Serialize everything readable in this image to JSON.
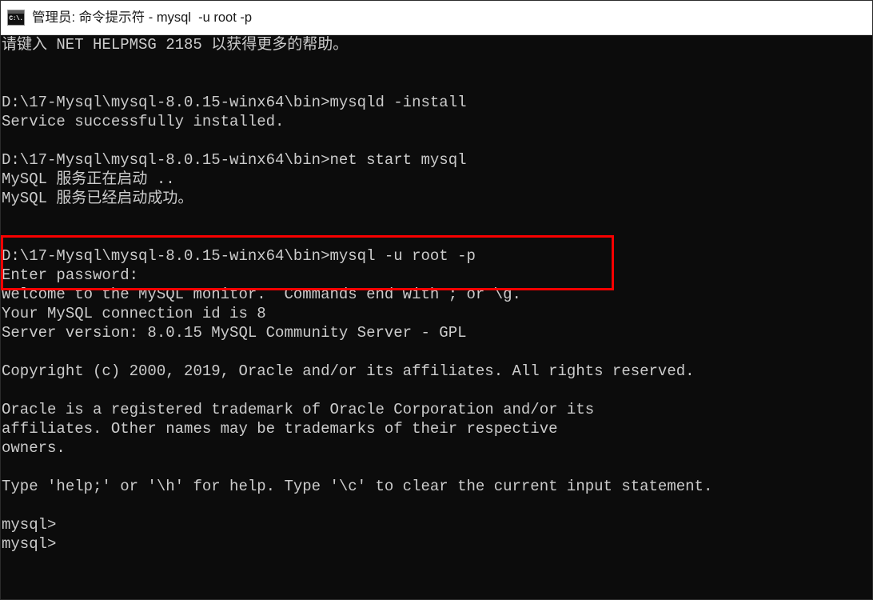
{
  "window": {
    "title": "管理员: 命令提示符 - mysql  -u root -p",
    "icon": "cmd-icon",
    "icon_label": "C:\\.",
    "background_color": "#0c0c0c",
    "text_color": "#cccccc",
    "titlebar_color": "#ffffff"
  },
  "annotation": {
    "type": "rectangle",
    "color": "#f70000",
    "target_lines": [
      "D:\\17-Mysql\\mysql-8.0.15-winx64\\bin>mysql -u root -p",
      "Enter password:"
    ]
  },
  "console": {
    "lines": [
      "请键入 NET HELPMSG 2185 以获得更多的帮助。",
      "",
      "",
      "D:\\17-Mysql\\mysql-8.0.15-winx64\\bin>mysqld -install",
      "Service successfully installed.",
      "",
      "D:\\17-Mysql\\mysql-8.0.15-winx64\\bin>net start mysql",
      "MySQL 服务正在启动 ..",
      "MySQL 服务已经启动成功。",
      "",
      "",
      "D:\\17-Mysql\\mysql-8.0.15-winx64\\bin>mysql -u root -p",
      "Enter password:",
      "Welcome to the MySQL monitor.  Commands end with ; or \\g.",
      "Your MySQL connection id is 8",
      "Server version: 8.0.15 MySQL Community Server - GPL",
      "",
      "Copyright (c) 2000, 2019, Oracle and/or its affiliates. All rights reserved.",
      "",
      "Oracle is a registered trademark of Oracle Corporation and/or its",
      "affiliates. Other names may be trademarks of their respective",
      "owners.",
      "",
      "Type 'help;' or '\\h' for help. Type '\\c' to clear the current input statement.",
      "",
      "mysql>",
      "mysql>"
    ]
  }
}
